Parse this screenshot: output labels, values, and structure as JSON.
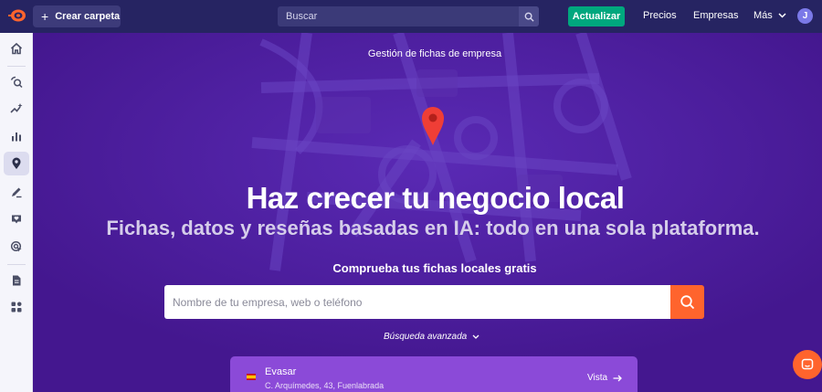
{
  "topbar": {
    "create_label": "Crear carpeta",
    "search_placeholder": "Buscar",
    "upgrade_label": "Actualizar",
    "prices_label": "Precios",
    "companies_label": "Empresas",
    "more_label": "Más",
    "avatar_letter": "J"
  },
  "sidebar": {
    "items": [
      {
        "icon": "home-icon"
      },
      {
        "icon": "seo-icon"
      },
      {
        "icon": "trends-icon"
      },
      {
        "icon": "bar-chart-icon"
      },
      {
        "icon": "location-pin-icon",
        "active": true
      },
      {
        "icon": "content-icon"
      },
      {
        "icon": "social-icon"
      },
      {
        "icon": "ads-target-icon"
      },
      {
        "icon": "report-icon"
      },
      {
        "icon": "apps-grid-icon"
      }
    ]
  },
  "hero": {
    "label": "Gestión de fichas de empresa",
    "title": "Haz crecer tu negocio local",
    "subtitle": "Fichas, datos y reseñas basadas en IA: todo en una sola plataforma.",
    "check_label": "Comprueba tus fichas locales gratis",
    "input_placeholder": "Nombre de tu empresa, web o teléfono",
    "advanced_label": "Búsqueda avanzada"
  },
  "result": {
    "name": "Evasar",
    "address": "C. Arquímedes, 43, Fuenlabrada",
    "view_label": "Vista"
  },
  "colors": {
    "topbar": "#262462",
    "hero": "#4a1a9e",
    "accent": "#ff642d",
    "upgrade": "#00a77e",
    "result_card": "#8b4ad8"
  }
}
